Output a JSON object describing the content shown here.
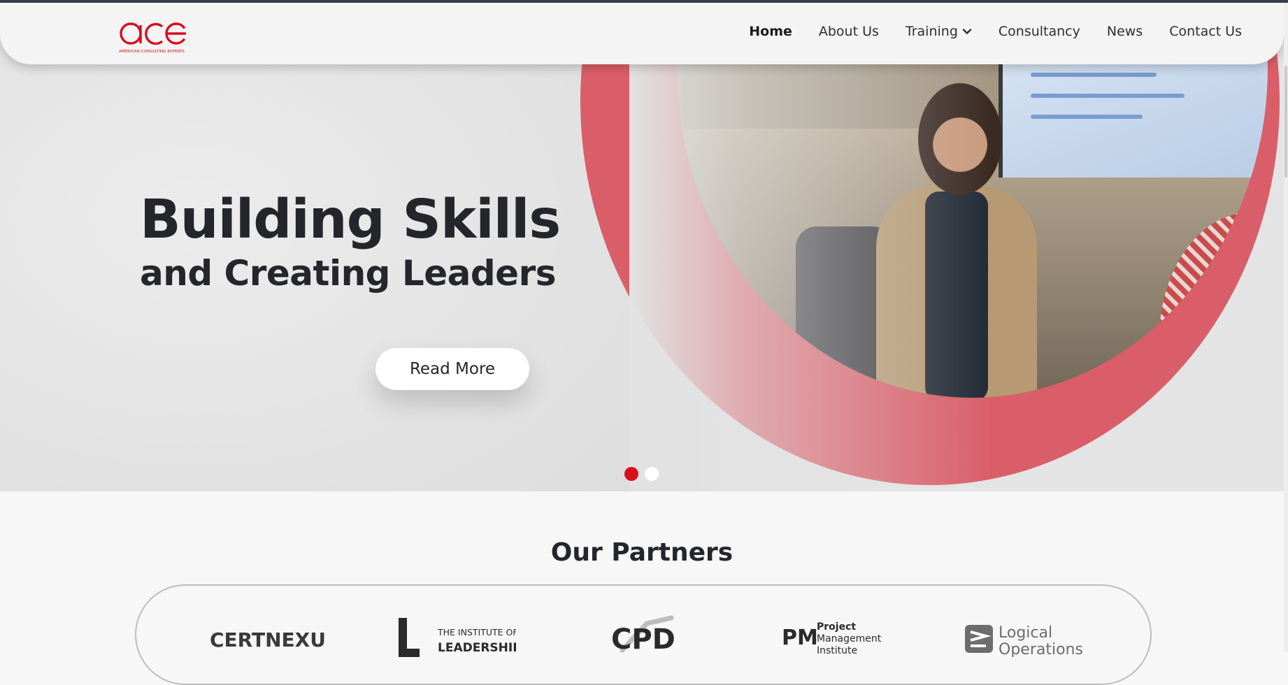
{
  "brand": {
    "logo_text": "ace",
    "logo_subtitle": "AMERICAN CONSULTING EXPERTS",
    "accent_color": "#d90d1e"
  },
  "nav": {
    "items": [
      {
        "label": "Home",
        "active": true
      },
      {
        "label": "About Us"
      },
      {
        "label": "Training",
        "has_dropdown": true
      },
      {
        "label": "Consultancy"
      },
      {
        "label": "News"
      },
      {
        "label": "Contact Us"
      }
    ]
  },
  "hero": {
    "title_line1": "Building Skills",
    "title_line2": "and Creating Leaders",
    "cta_label": "Read More",
    "slides": {
      "count": 2,
      "active_index": 0
    },
    "dot_active_color": "#d90d1e",
    "dot_inactive_color": "#ffffff"
  },
  "partners": {
    "title": "Our Partners",
    "items": [
      {
        "name": "CERTNEXUS",
        "icon": "certnexus-logo"
      },
      {
        "name": "THE INSTITUTE OF LEADERSHIP",
        "icon": "institute-of-leadership-logo"
      },
      {
        "name": "CPD",
        "icon": "cpd-logo"
      },
      {
        "name": "Project Management Institute",
        "icon": "pmi-logo"
      },
      {
        "name": "Logical Operations",
        "icon": "logical-operations-logo"
      }
    ]
  }
}
